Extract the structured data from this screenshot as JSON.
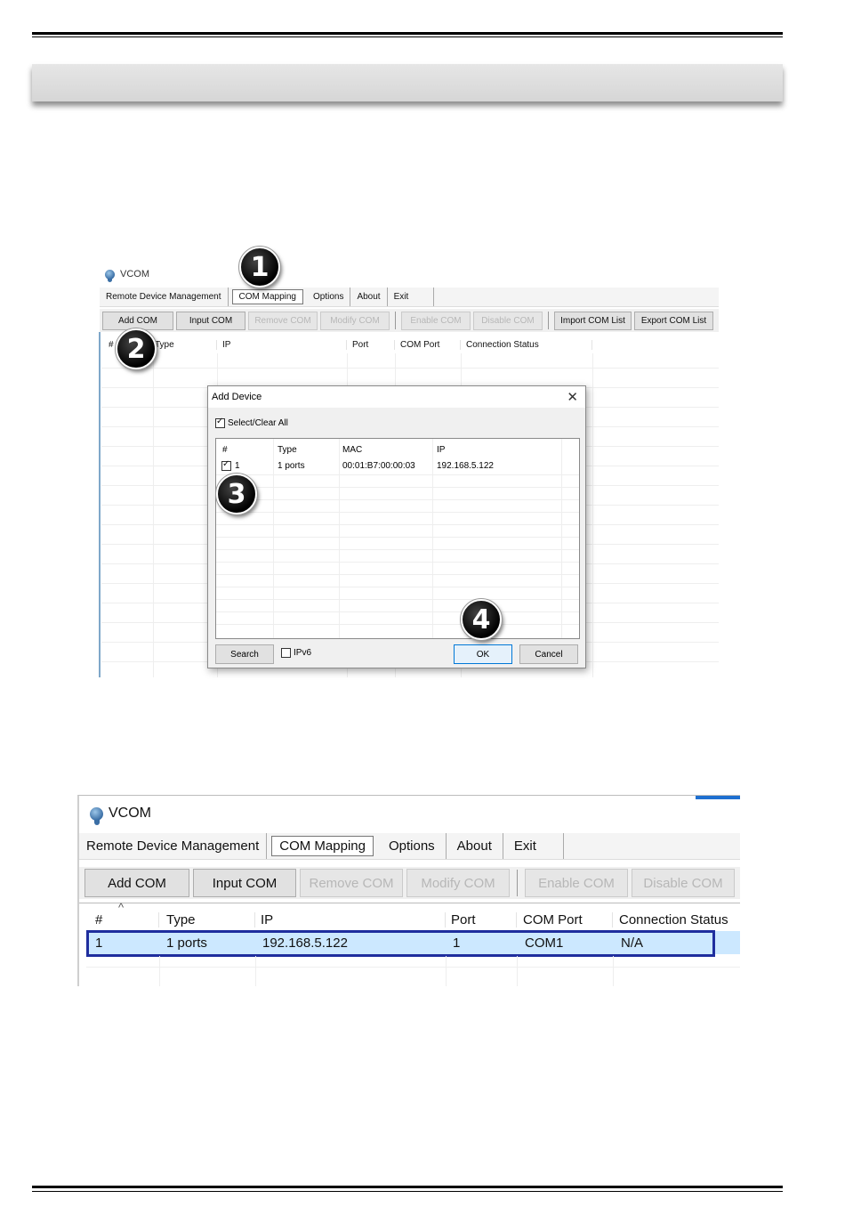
{
  "screenshot1": {
    "window_title": "VCOM",
    "menu": [
      "Remote Device Management",
      "COM Mapping",
      "Options",
      "About",
      "Exit"
    ],
    "toolbar": {
      "add_com": "Add COM",
      "input_com": "Input COM",
      "remove_com": "Remove COM",
      "modify_com": "Modify COM",
      "enable_com": "Enable COM",
      "disable_com": "Disable COM",
      "import_list": "Import COM List",
      "export_list": "Export COM List"
    },
    "columns": [
      "#",
      "Type",
      "IP",
      "Port",
      "COM Port",
      "Connection Status"
    ],
    "dialog": {
      "title": "Add Device",
      "close": "✕",
      "select_all": "Select/Clear All",
      "columns": [
        "#",
        "Type",
        "MAC",
        "IP"
      ],
      "row": {
        "num": "1",
        "type": "1 ports",
        "mac": "00:01:B7:00:00:03",
        "ip": "192.168.5.122"
      },
      "search": "Search",
      "ipv6": "IPv6",
      "ok": "OK",
      "cancel": "Cancel"
    },
    "markers": [
      "1",
      "2",
      "3",
      "4"
    ]
  },
  "screenshot2": {
    "window_title": "VCOM",
    "menu": [
      "Remote Device Management",
      "COM Mapping",
      "Options",
      "About",
      "Exit"
    ],
    "toolbar": {
      "add_com": "Add COM",
      "input_com": "Input COM",
      "remove_com": "Remove COM",
      "modify_com": "Modify COM",
      "enable_com": "Enable COM",
      "disable_com": "Disable COM"
    },
    "columns": [
      "#",
      "Type",
      "IP",
      "Port",
      "COM Port",
      "Connection Status"
    ],
    "row": {
      "num": "1",
      "type": "1 ports",
      "ip": "192.168.5.122",
      "port": "1",
      "com_port": "COM1",
      "status": "N/A"
    },
    "sort_glyph": "^"
  },
  "colors": {
    "highlight_box": "#1f2e9e",
    "row_selected": "#cce8ff",
    "ok_border": "#0078d7"
  }
}
